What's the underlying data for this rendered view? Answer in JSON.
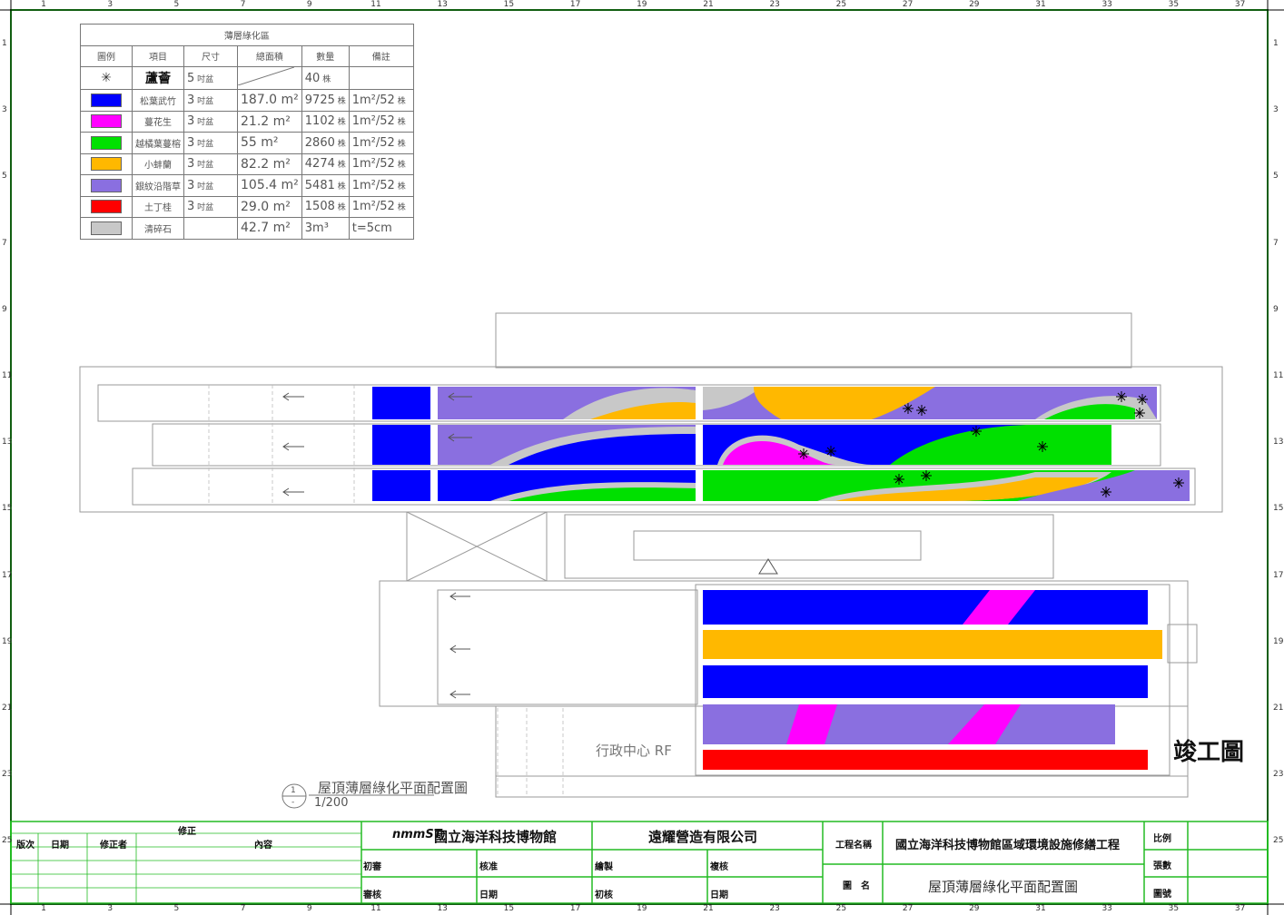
{
  "ruler": {
    "columns": [
      "1",
      "3",
      "5",
      "7",
      "9",
      "11",
      "13",
      "15",
      "17",
      "19",
      "21",
      "23",
      "25",
      "27",
      "29",
      "31",
      "33",
      "35",
      "37"
    ],
    "rows": [
      "1",
      "3",
      "5",
      "7",
      "9",
      "11",
      "13",
      "15",
      "17",
      "19",
      "21",
      "23",
      "25"
    ]
  },
  "legend": {
    "title": "薄層綠化區",
    "headers": [
      "圖例",
      "項目",
      "尺寸",
      "總面積",
      "數量",
      "備註"
    ],
    "rows": [
      {
        "swatch": "",
        "icon": "star-shrub-icon",
        "name": "蘆薈",
        "size": "5",
        "size_unit": "吋盆",
        "area": "",
        "qty": "40",
        "qty_unit": "株",
        "note": ""
      },
      {
        "swatch": "#0000FF",
        "name": "松葉武竹",
        "size": "3",
        "size_unit": "吋盆",
        "area": "187.0 m²",
        "qty": "9725",
        "qty_unit": "株",
        "note": "1m²/52",
        "note_unit": "株"
      },
      {
        "swatch": "#FF00FF",
        "name": "蔓花生",
        "size": "3",
        "size_unit": "吋盆",
        "area": "21.2 m²",
        "qty": "1102",
        "qty_unit": "株",
        "note": "1m²/52",
        "note_unit": "株"
      },
      {
        "swatch": "#00E000",
        "name": "越橘葉蔓榕",
        "size": "3",
        "size_unit": "吋盆",
        "area": "55 m²",
        "qty": "2860",
        "qty_unit": "株",
        "note": "1m²/52",
        "note_unit": "株"
      },
      {
        "swatch": "#FFB800",
        "name": "小蚌蘭",
        "size": "3",
        "size_unit": "吋盆",
        "area": "82.2 m²",
        "qty": "4274",
        "qty_unit": "株",
        "note": "1m²/52",
        "note_unit": "株"
      },
      {
        "swatch": "#8A6FE0",
        "name": "銀紋沿階草",
        "size": "3",
        "size_unit": "吋盆",
        "area": "105.4 m²",
        "qty": "5481",
        "qty_unit": "株",
        "note": "1m²/52",
        "note_unit": "株"
      },
      {
        "swatch": "#FF0000",
        "name": "土丁桂",
        "size": "3",
        "size_unit": "吋盆",
        "area": "29.0 m²",
        "qty": "1508",
        "qty_unit": "株",
        "note": "1m²/52",
        "note_unit": "株"
      },
      {
        "swatch": "#C8C8C8",
        "name": "清碎石",
        "size": "",
        "size_unit": "",
        "area": "42.7 m²",
        "qty": "3m³",
        "qty_unit": "",
        "note": "t=5cm",
        "note_unit": ""
      }
    ]
  },
  "colors": {
    "blue": "#0000FF",
    "magenta": "#FF00FF",
    "green": "#00E000",
    "orange": "#FFB800",
    "purple": "#8A6FE0",
    "red": "#FF0000",
    "gravel": "#C8C8C8",
    "frame": "#22BB22"
  },
  "plan": {
    "title": "屋頂薄層綠化平面配置圖",
    "scale": "1/200",
    "callout_top": "1",
    "callout_bottom": "-",
    "area_label": "行政中心 RF",
    "stamp": "竣工圖"
  },
  "title_block": {
    "revision_header": "修正",
    "revision_cols": [
      "版次",
      "日期",
      "修正者",
      "內容"
    ],
    "owner_logo": "nmmST",
    "owner": "國立海洋科技博物館",
    "contractor": "遠耀營造有限公司",
    "project_label": "工程名稱",
    "project_name": "國立海洋科技博物館區域環境設施修繕工程",
    "drawing_label": "圖　名",
    "drawing_name": "屋頂薄層綠化平面配置圖",
    "sign": {
      "first_review": "初審",
      "approve": "核准",
      "draw": "繪製",
      "recheck": "複核",
      "review": "審核",
      "date1": "日期",
      "initial_check": "初核",
      "date2": "日期"
    },
    "scale_label": "比例",
    "sheets_label": "張數",
    "number_label": "圖號"
  }
}
